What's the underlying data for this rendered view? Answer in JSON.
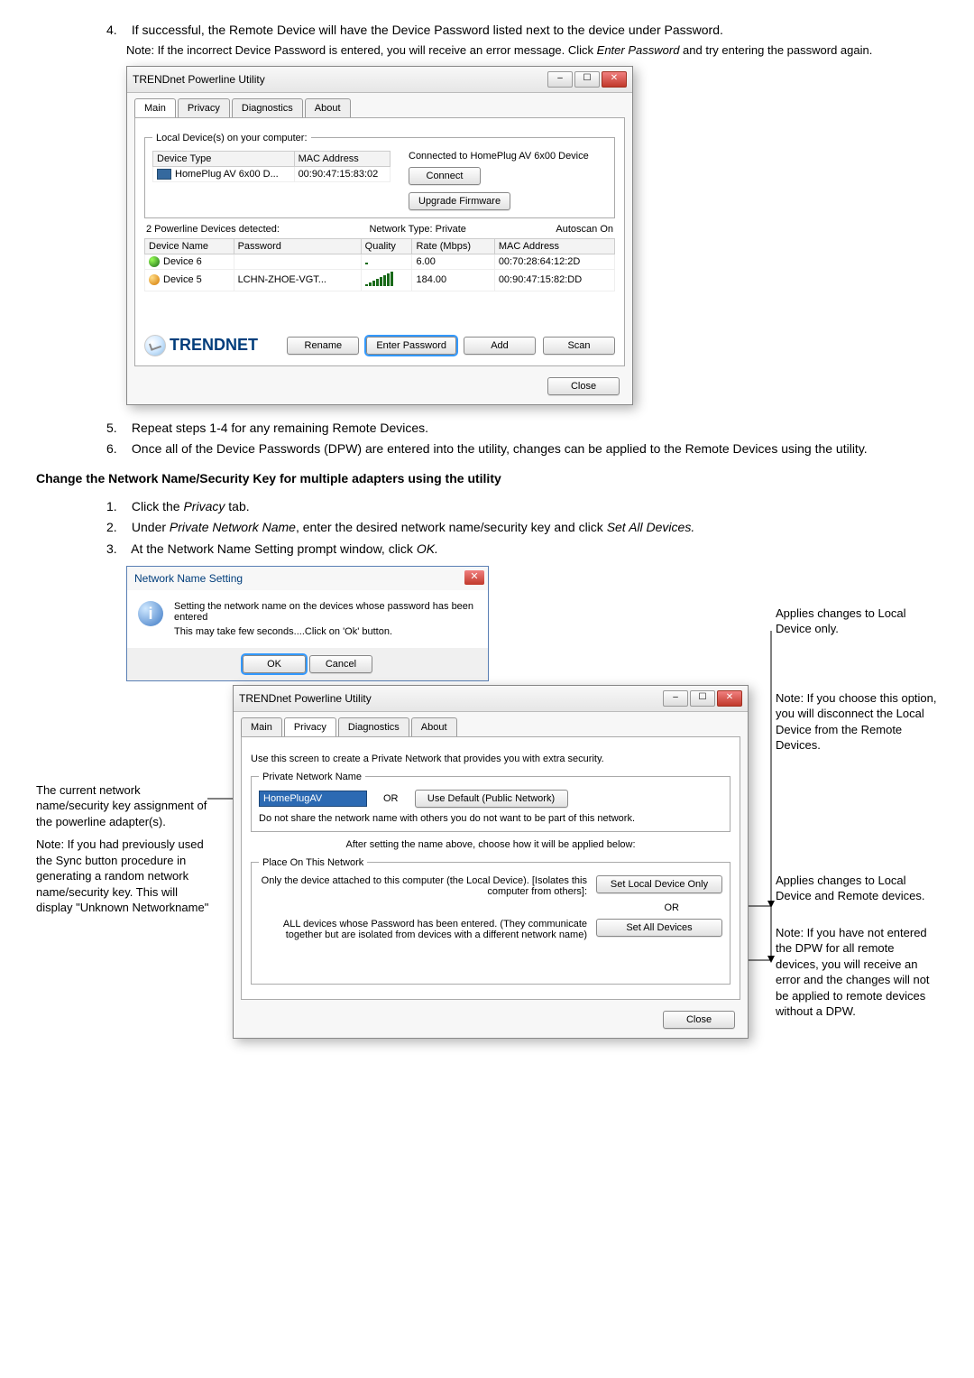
{
  "steps_a": {
    "s4": "If successful, the Remote Device will have the Device Password listed next to the device under Password.",
    "s4_note_a": "Note: If the incorrect Device Password is entered, you will receive an error message. Click ",
    "s4_note_b": "Enter Password",
    "s4_note_c": " and try entering the password again."
  },
  "utility1": {
    "title": "TRENDnet Powerline Utility",
    "tabs": [
      "Main",
      "Privacy",
      "Diagnostics",
      "About"
    ],
    "local_group": "Local Device(s) on your computer:",
    "col_devtype": "Device Type",
    "col_mac": "MAC Address",
    "local_row_dev": "HomePlug AV 6x00 D...",
    "local_row_mac": "00:90:47:15:83:02",
    "connected": "Connected to HomePlug AV 6x00 Device",
    "btn_connect": "Connect",
    "btn_upgrade": "Upgrade Firmware",
    "detected": "2 Powerline Devices detected:",
    "nettype": "Network Type: Private",
    "autoscan": "Autoscan On",
    "cols": {
      "name": "Device Name",
      "pw": "Password",
      "quality": "Quality",
      "rate": "Rate (Mbps)",
      "mac": "MAC Address"
    },
    "rows": [
      {
        "name": "Device 6",
        "pw": "",
        "quality_full": true,
        "rate": "6.00",
        "mac": "00:70:28:64:12:2D"
      },
      {
        "name": "Device 5",
        "pw": "LCHN-ZHOE-VGT...",
        "quality_full": false,
        "rate": "184.00",
        "mac": "00:90:47:15:82:DD"
      }
    ],
    "logo": "TRENDNET",
    "btn_rename": "Rename",
    "btn_enterpw": "Enter Password",
    "btn_add": "Add",
    "btn_scan": "Scan",
    "btn_close": "Close"
  },
  "steps_b": {
    "s5": "Repeat steps 1-4 for any remaining Remote Devices.",
    "s6": "Once all of the Device Passwords (DPW) are entered into the utility, changes can be applied to the Remote Devices using the utility."
  },
  "section_title": "Change the Network Name/Security Key for multiple adapters using the utility",
  "steps_c": {
    "s1": "Click the ",
    "s1_i": "Privacy",
    "s1_end": " tab.",
    "s2": "Under ",
    "s2_i": "Private Network Name",
    "s2_mid": ", enter the desired network name/security key and click ",
    "s2_i2": "Set All Devices.",
    "s3": "At the Network Name Setting prompt window, click ",
    "s3_i": "OK."
  },
  "msgbox": {
    "title": "Network Name Setting",
    "line1": "Setting the network name on the devices whose password has been entered",
    "line2": "This may take few seconds....Click on 'Ok' button.",
    "btn_ok": "OK",
    "btn_cancel": "Cancel"
  },
  "utility2": {
    "title": "TRENDnet Powerline Utility",
    "tabs": [
      "Main",
      "Privacy",
      "Diagnostics",
      "About"
    ],
    "screen_note": "Use this screen to create a Private Network that provides you with extra security.",
    "grp_private": "Private Network Name",
    "hp_val": "HomePlugAV",
    "or": "OR",
    "btn_usedef": "Use Default (Public Network)",
    "donotshare": "Do not share the network name with others you do not want to be part of this network.",
    "aftset": "After setting the name above, choose how it will be applied below:",
    "grp_place": "Place On This Network",
    "only_dev": "Only the device attached to this computer (the Local Device). [Isolates this computer from others]:",
    "btn_setlocal": "Set Local Device Only",
    "all_dev": "ALL devices whose Password has been entered. (They communicate together but are isolated from devices with a different network name)",
    "btn_setall": "Set All Devices",
    "btn_close": "Close"
  },
  "anno": {
    "left_a": "The current network name/security key assignment of the powerline adapter(s).",
    "left_b": "Note: If you had previously used the Sync button procedure in generating a random network name/security key. This will display \"Unknown Networkname\"",
    "r1": "Applies changes to Local Device only.",
    "r2": "Note: If you choose this option, you will disconnect the Local Device from the Remote Devices.",
    "r3": "Applies changes to Local Device and Remote devices.",
    "r4": "Note: If you have not entered the DPW for all remote devices, you will receive an error and the changes will not be applied to remote devices without a DPW."
  }
}
